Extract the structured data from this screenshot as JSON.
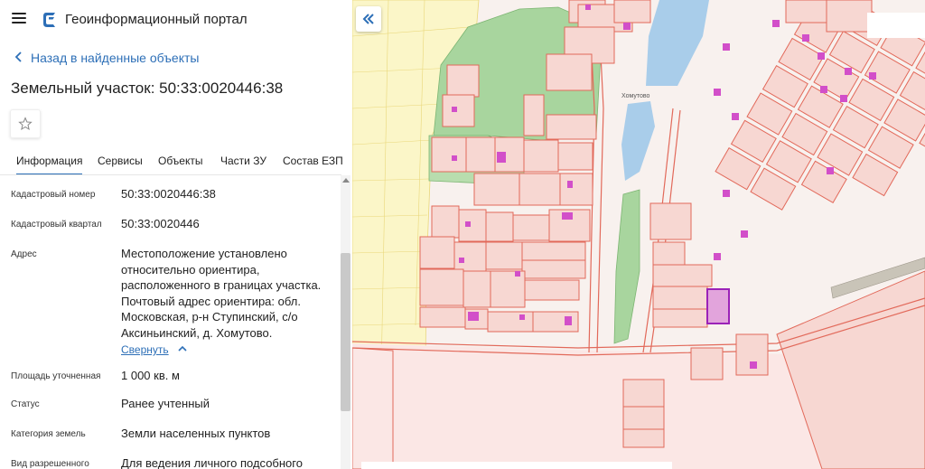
{
  "header": {
    "app_title": "Геоинформационный портал"
  },
  "nav": {
    "back_label": "Назад в найденные объекты"
  },
  "page": {
    "title": "Земельный участок: 50:33:0020446:38"
  },
  "tabs": [
    "Информация",
    "Сервисы",
    "Объекты",
    "Части ЗУ",
    "Состав ЕЗП"
  ],
  "info": {
    "cad_number": {
      "label": "Кадастровый номер",
      "value": "50:33:0020446:38"
    },
    "cad_quarter": {
      "label": "Кадастровый квартал",
      "value": "50:33:0020446"
    },
    "address": {
      "label": "Адрес",
      "lines": [
        "Местоположение установлено",
        "относительно ориентира,",
        "расположенного в границах участка.",
        "Почтовый адрес ориентира: обл.",
        "Московская, р-н Ступинский, с/о",
        "Аксиньинский, д. Хомутово."
      ],
      "collapse_label": "Свернуть"
    },
    "area": {
      "label": "Площадь уточненная",
      "value": "1 000 кв. м"
    },
    "status": {
      "label": "Статус",
      "value": "Ранее учтенный"
    },
    "land_category": {
      "label": "Категория земель",
      "value": "Земли населенных пунктов"
    },
    "permitted_use": {
      "label": "Вид разрешенного",
      "value": "Для ведения личного подсобного"
    }
  },
  "map": {
    "place_label": "Хомутово"
  },
  "icons": {
    "menu": "hamburger-icon",
    "logo": "portal-logo-icon",
    "back": "chevron-left-icon",
    "favorite": "star-icon",
    "collapse": "chevron-up-icon",
    "panel_toggle": "double-chevron-left-icon"
  },
  "colors": {
    "accent": "#2d6fb7",
    "parcel_stroke": "#e2695a",
    "parcel_fill": "#f7d7d2",
    "building": "#d24fc9",
    "selected_parcel": "#9b22b8",
    "forest": "#a8d59e",
    "water": "#a9cdea",
    "yellow_zone": "#fbf6c8"
  }
}
